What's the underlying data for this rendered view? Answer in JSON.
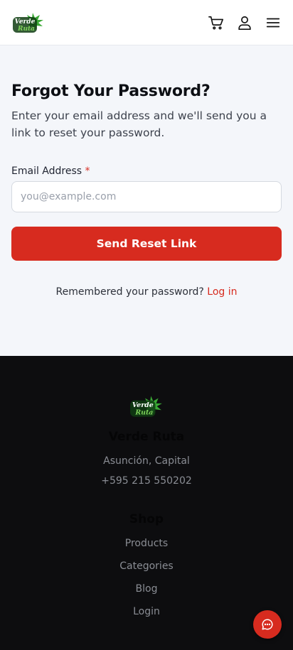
{
  "header": {
    "logo_line1": "Verde",
    "logo_line2": "Ruta",
    "icons": [
      "cart-icon",
      "user-icon",
      "menu-icon"
    ]
  },
  "form": {
    "title": "Forgot Your Password?",
    "subtitle": "Enter your email address and we'll send you a link to reset your password.",
    "email_label": "Email Address",
    "required_mark": "*",
    "email_placeholder": "you@example.com",
    "email_value": "",
    "submit_label": "Send Reset Link",
    "login_prompt": "Remembered your password?",
    "login_link": "Log in"
  },
  "footer": {
    "logo_line1": "Verde",
    "logo_line2": "Ruta",
    "brand": "Verde Ruta",
    "location": "Asunción, Capital",
    "phone": "+595 215 550202",
    "shop_heading": "Shop",
    "links": [
      "Products",
      "Categories",
      "Blog",
      "Login"
    ]
  },
  "colors": {
    "accent": "#d72b1f",
    "footer_bg": "#0d0d0f",
    "logo_green": "#3aa935"
  }
}
